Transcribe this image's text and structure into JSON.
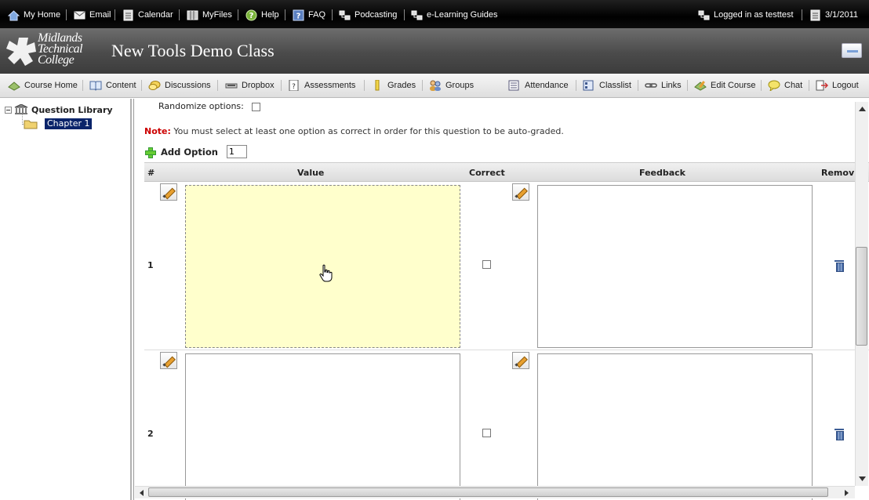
{
  "topbar": {
    "items": [
      {
        "label": "My Home",
        "icon": "home-icon"
      },
      {
        "label": "Email",
        "icon": "email-icon"
      },
      {
        "label": "Calendar",
        "icon": "calendar-icon"
      },
      {
        "label": "MyFiles",
        "icon": "files-icon"
      },
      {
        "label": "Help",
        "icon": "help-icon"
      },
      {
        "label": "FAQ",
        "icon": "faq-icon"
      },
      {
        "label": "Podcasting",
        "icon": "podcast-icon"
      },
      {
        "label": "e-Learning Guides",
        "icon": "guides-icon"
      }
    ],
    "logged_in": "Logged in as testtest",
    "date": "3/1/2011"
  },
  "banner": {
    "logo_lines": [
      "Midlands",
      "Technical",
      "College"
    ],
    "course_title": "New Tools Demo Class"
  },
  "navbar": {
    "items": [
      {
        "label": "Course Home",
        "icon": "course-home-icon"
      },
      {
        "label": "Content",
        "icon": "content-icon"
      },
      {
        "label": "Discussions",
        "icon": "discussions-icon"
      },
      {
        "label": "Dropbox",
        "icon": "dropbox-icon"
      },
      {
        "label": "Assessments",
        "icon": "assessments-icon"
      },
      {
        "label": "Grades",
        "icon": "grades-icon"
      },
      {
        "label": "Groups",
        "icon": "groups-icon"
      },
      {
        "label": "Attendance",
        "icon": "attendance-icon"
      },
      {
        "label": "Classlist",
        "icon": "classlist-icon"
      },
      {
        "label": "Links",
        "icon": "links-icon"
      },
      {
        "label": "Edit Course",
        "icon": "edit-course-icon"
      },
      {
        "label": "Chat",
        "icon": "chat-icon"
      },
      {
        "label": "Logout",
        "icon": "logout-icon"
      }
    ]
  },
  "tree": {
    "root": "Question Library",
    "child": "Chapter 1"
  },
  "form": {
    "randomize_label": "Randomize options:",
    "note_label": "Note:",
    "note_text": " You must select at least one option as correct in order for this question to be auto-graded.",
    "add_option_label": "Add Option",
    "add_option_count": "1",
    "columns": [
      "#",
      "Value",
      "Correct",
      "Feedback",
      "Remov"
    ],
    "rows": [
      {
        "number": "1"
      },
      {
        "number": "2"
      }
    ]
  },
  "colors": {
    "note": "#cc0000",
    "active_editor": "#ffffcc",
    "selected_tree": "#0a246a"
  }
}
